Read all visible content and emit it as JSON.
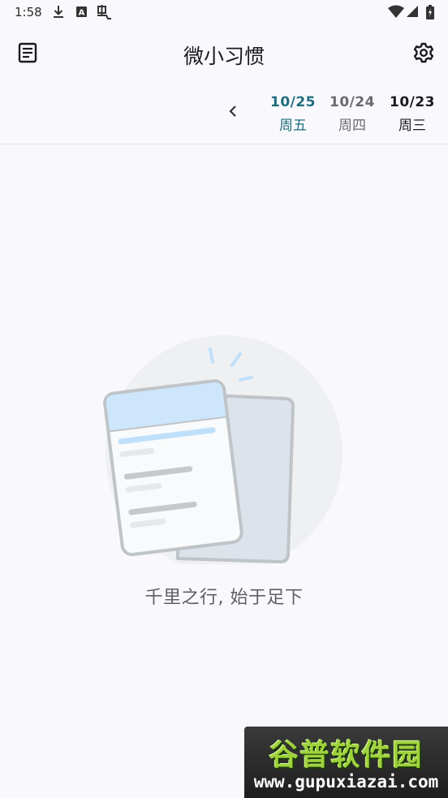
{
  "status_bar": {
    "time": "1:58",
    "left_icons": [
      "download-icon",
      "a-box-icon",
      "bug-icon"
    ],
    "right_icons": [
      "wifi-icon",
      "signal-icon",
      "battery-icon"
    ]
  },
  "app_bar": {
    "title": "微小习惯",
    "left_icon": "list-icon",
    "right_icon": "gear-icon"
  },
  "date_strip": {
    "prev_icon": "chevron-left-icon",
    "dates": [
      {
        "date": "10/25",
        "weekday": "周五",
        "selected": true
      },
      {
        "date": "10/24",
        "weekday": "周四",
        "selected": false
      },
      {
        "date": "10/23",
        "weekday": "周三",
        "selected": false
      }
    ]
  },
  "empty_state": {
    "illustration": "empty-notes-illustration",
    "message": "千里之行, 始于足下"
  },
  "watermark": {
    "title": "谷普软件园",
    "url": "www.gupuxiazai.com"
  },
  "colors": {
    "background": "#f9f9fd",
    "accent": "#1f6d7d",
    "illustration_header": "#cde6fb",
    "illustration_circle": "#eff0f2"
  }
}
